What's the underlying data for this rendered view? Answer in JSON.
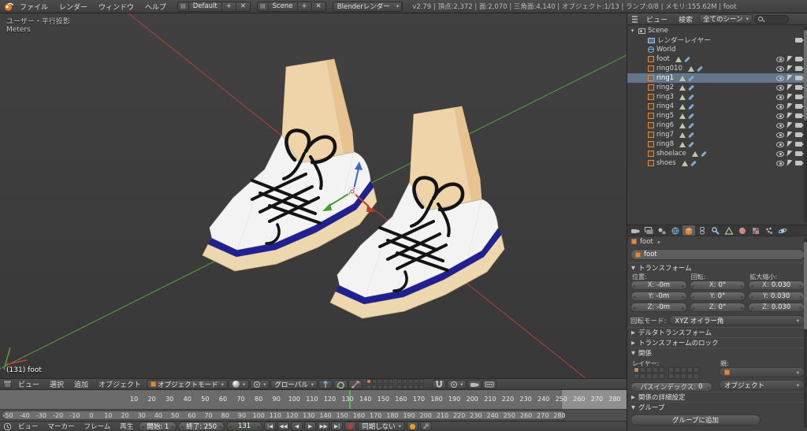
{
  "topbar": {
    "menus": [
      "ファイル",
      "レンダー",
      "ウィンドウ",
      "ヘルプ"
    ],
    "layout_name": "Default",
    "scene_name": "Scene",
    "engine": "Blenderレンダー",
    "stats": "v2.79 | 頂点:2,372 | 面:2,070 | 三角面:4,140 | オブジェクト:1/13 | ランプ:0/8 | メモリ:155.62M | foot"
  },
  "viewport": {
    "view_label": "ユーザー・平行投影",
    "unit_label": "Meters",
    "object_info": "(131) foot",
    "colors": {
      "bg": "#3b3b3b",
      "axis_x": "#a23e3e",
      "axis_y": "#568f3f",
      "playhead": "#55b855",
      "select_highlight": "#647689"
    }
  },
  "view3d": {
    "menus": [
      "ビュー",
      "選択",
      "追加",
      "オブジェクト"
    ],
    "mode": "オブジェクトモード",
    "orientation": "グローバル",
    "icons": [
      "editor-type-icon",
      "object-mode-cube-icon",
      "viewport-shading-icon",
      "pivot-center-icon",
      "manipulator-translate-icon",
      "manipulator-rotate-icon",
      "manipulator-scale-icon",
      "snap-magnet-icon",
      "render-still-icon",
      "render-anim-icon"
    ]
  },
  "timeline": {
    "menus": [
      "ビュー",
      "マーカー",
      "フレーム",
      "再生"
    ],
    "start_label": "開始: 1",
    "end_label": "終了: 250",
    "current_frame": "131",
    "current_frame_num": 131,
    "range_end": 250,
    "sync_mode": "同期しない",
    "playback": [
      "|◀",
      "◀◀",
      "◀",
      "▶",
      "▶▶",
      "▶|"
    ],
    "ruler_main": {
      "min": 10,
      "max": 280,
      "step": 10
    },
    "ruler_scroll": {
      "min": -50,
      "max": 280,
      "step": 10
    }
  },
  "outliner": {
    "header": {
      "view": "ビュー",
      "search": "検索",
      "scope": "全てのシーン"
    },
    "rows": [
      {
        "label": "Scene",
        "icon": "scene",
        "indent": 0,
        "expander": "▾",
        "toggles": "none",
        "data": false
      },
      {
        "label": "レンダーレイヤー",
        "icon": "renderlayer",
        "indent": 1,
        "toggles": "cam",
        "data": false
      },
      {
        "label": "World",
        "icon": "world",
        "indent": 1,
        "toggles": "none",
        "data": false
      },
      {
        "label": "foot",
        "icon": "object",
        "indent": 1,
        "toggles": "all",
        "data": true
      },
      {
        "label": "ring010",
        "icon": "object",
        "indent": 1,
        "toggles": "all",
        "data": true
      },
      {
        "label": "ring1",
        "icon": "object",
        "indent": 1,
        "toggles": "all",
        "data": true,
        "selected": true
      },
      {
        "label": "ring2",
        "icon": "object",
        "indent": 1,
        "toggles": "all",
        "data": true
      },
      {
        "label": "ring3",
        "icon": "object",
        "indent": 1,
        "toggles": "all",
        "data": true
      },
      {
        "label": "ring4",
        "icon": "object",
        "indent": 1,
        "toggles": "all",
        "data": true
      },
      {
        "label": "ring5",
        "icon": "object",
        "indent": 1,
        "toggles": "all",
        "data": true
      },
      {
        "label": "ring6",
        "icon": "object",
        "indent": 1,
        "toggles": "all",
        "data": true
      },
      {
        "label": "ring7",
        "icon": "object",
        "indent": 1,
        "toggles": "all",
        "data": true
      },
      {
        "label": "ring8",
        "icon": "object",
        "indent": 1,
        "toggles": "all",
        "data": true
      },
      {
        "label": "shoelace",
        "icon": "object",
        "indent": 1,
        "toggles": "all",
        "data": true
      },
      {
        "label": "shoes",
        "icon": "object",
        "indent": 1,
        "toggles": "all",
        "data": true
      }
    ]
  },
  "properties": {
    "tabs": [
      "render",
      "render-layers",
      "scene",
      "world",
      "object",
      "constraints",
      "modifiers",
      "object-data",
      "material",
      "texture",
      "particles",
      "physics"
    ],
    "active_tab": "object",
    "breadcrumb": "foot",
    "name_value": "foot",
    "panels": {
      "transform": "トランスフォーム",
      "delta": "デルタトランスフォーム",
      "lock": "トランスフォームのロック",
      "relations": "関係",
      "relations_extra": "関係の詳細設定",
      "group": "グループ"
    },
    "transform": {
      "loc_title": "位置:",
      "rot_title": "回転:",
      "scale_title": "拡大縮小:",
      "axis_labels": [
        "X:",
        "Y:",
        "Z:"
      ],
      "loc": [
        "-0m",
        "-0m",
        "-0m"
      ],
      "rot": [
        "0°",
        "0°",
        "0°"
      ],
      "scale": [
        "0.030",
        "0.030",
        "0.030"
      ],
      "rotmode_label": "回転モード:",
      "rotmode_value": "XYZ オイラー角"
    },
    "relations": {
      "layers_label": "レイヤー:",
      "parent_label": "親:",
      "parent_type": "オブジェクト",
      "pass_label": "パスインデックス:",
      "pass_value": "0"
    },
    "group": {
      "add_label": "グループに追加"
    }
  }
}
